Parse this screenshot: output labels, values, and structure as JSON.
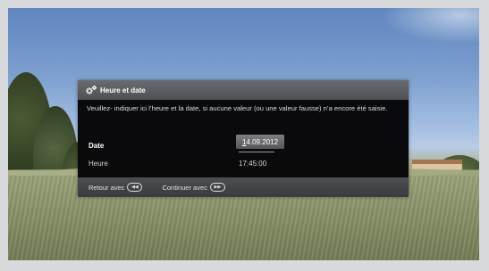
{
  "dialog": {
    "title": "Heure et date",
    "icon": "gear-icon",
    "message": "Veuillez- indiquer ici l’heure et la date, si aucune valeur (ou une valeur fausse) n’a encore été saisie.",
    "fields": {
      "date_label": "Date",
      "date_first_char": "1",
      "date_rest": "4.09.2012",
      "time_label": "Heure",
      "time_value": "17:45:00"
    },
    "footer": {
      "back_label": "Retour avec",
      "back_icon": "rewind-icon",
      "back_glyph": "◀◀",
      "next_label": "Continuer avec",
      "next_icon": "fast-forward-icon",
      "next_glyph": "▶▶"
    }
  },
  "colors": {
    "dialog_bg": "#141416",
    "header_bg": "#5d5e61",
    "field_highlight": "#6a6b6e",
    "text": "#e6e6e6"
  }
}
